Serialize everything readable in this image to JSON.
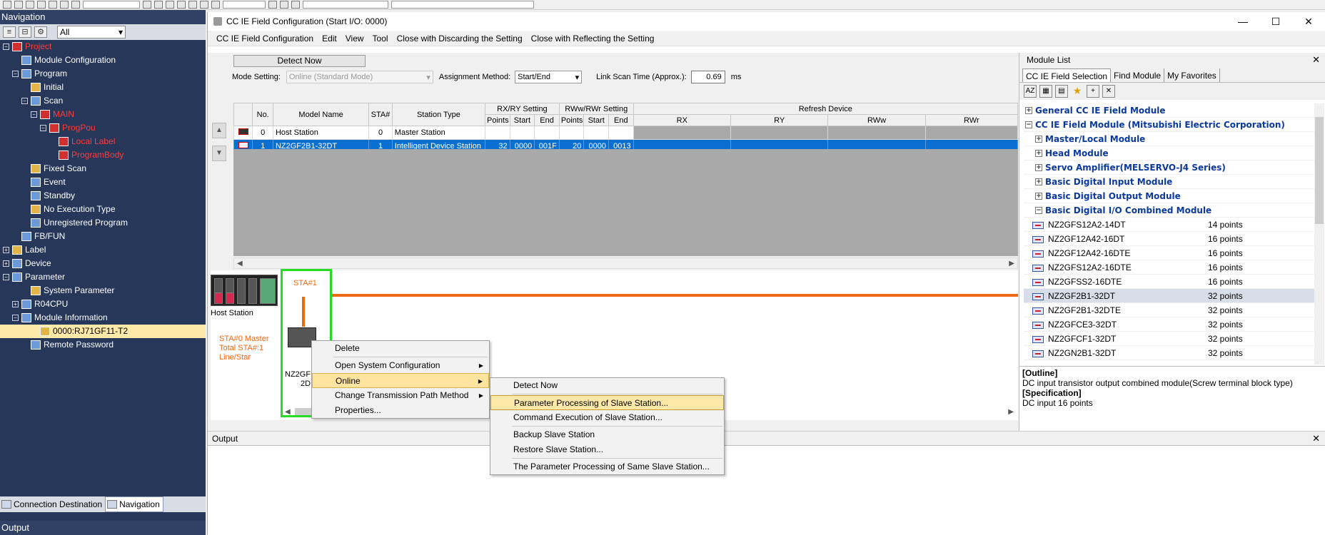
{
  "navigation": {
    "title": "Navigation",
    "filter": "All",
    "tree": [
      {
        "label": "Project",
        "indent": 0,
        "exp": "-",
        "style": "red",
        "icon": "project-icon"
      },
      {
        "label": "Module Configuration",
        "indent": 1,
        "exp": "",
        "style": "",
        "icon": "module-config-icon"
      },
      {
        "label": "Program",
        "indent": 1,
        "exp": "-",
        "style": "",
        "icon": "program-icon"
      },
      {
        "label": "Initial",
        "indent": 2,
        "exp": "",
        "style": "",
        "icon": "folder-icon"
      },
      {
        "label": "Scan",
        "indent": 2,
        "exp": "-",
        "style": "",
        "icon": "folder-icon"
      },
      {
        "label": "MAIN",
        "indent": 3,
        "exp": "-",
        "style": "red",
        "icon": "program-file-icon"
      },
      {
        "label": "ProgPou",
        "indent": 4,
        "exp": "-",
        "style": "red",
        "icon": "pou-icon"
      },
      {
        "label": "Local Label",
        "indent": 5,
        "exp": "",
        "style": "red",
        "icon": "local-label-icon"
      },
      {
        "label": "ProgramBody",
        "indent": 5,
        "exp": "",
        "style": "red",
        "icon": "program-body-icon"
      },
      {
        "label": "Fixed Scan",
        "indent": 2,
        "exp": "",
        "style": "",
        "icon": "folder-icon"
      },
      {
        "label": "Event",
        "indent": 2,
        "exp": "",
        "style": "",
        "icon": "folder-icon"
      },
      {
        "label": "Standby",
        "indent": 2,
        "exp": "",
        "style": "",
        "icon": "folder-icon"
      },
      {
        "label": "No Execution Type",
        "indent": 2,
        "exp": "",
        "style": "",
        "icon": "folder-icon"
      },
      {
        "label": "Unregistered Program",
        "indent": 2,
        "exp": "",
        "style": "",
        "icon": "folder-icon"
      },
      {
        "label": "FB/FUN",
        "indent": 1,
        "exp": "",
        "style": "",
        "icon": "fb-icon"
      },
      {
        "label": "Label",
        "indent": 0,
        "exp": "+",
        "style": "",
        "icon": "label-icon"
      },
      {
        "label": "Device",
        "indent": 0,
        "exp": "+",
        "style": "",
        "icon": "device-icon"
      },
      {
        "label": "Parameter",
        "indent": 0,
        "exp": "-",
        "style": "",
        "icon": "parameter-icon"
      },
      {
        "label": "System Parameter",
        "indent": 2,
        "exp": "",
        "style": "",
        "icon": "system-parameter-icon"
      },
      {
        "label": "R04CPU",
        "indent": 1,
        "exp": "+",
        "style": "",
        "icon": "cpu-icon"
      },
      {
        "label": "Module Information",
        "indent": 1,
        "exp": "-",
        "style": "",
        "icon": "module-info-icon"
      },
      {
        "label": "0000:RJ71GF11-T2",
        "indent": 3,
        "exp": "",
        "style": "selected",
        "icon": "module-icon"
      },
      {
        "label": "Remote Password",
        "indent": 2,
        "exp": "",
        "style": "",
        "icon": "password-icon"
      }
    ],
    "tabs": [
      "Connection Destination",
      "Navigation"
    ],
    "output_label": "Output"
  },
  "window": {
    "title": "CC IE Field Configuration (Start I/O: 0000)",
    "menu": [
      "CC IE Field Configuration",
      "Edit",
      "View",
      "Tool",
      "Close with Discarding the Setting",
      "Close with Reflecting the Setting"
    ]
  },
  "config": {
    "detect_now": "Detect Now",
    "mode_label": "Mode Setting:",
    "mode_value": "Online (Standard Mode)",
    "assign_label": "Assignment Method:",
    "assign_value": "Start/End",
    "scan_label": "Link Scan Time (Approx.):",
    "scan_value": "0.69",
    "scan_unit": "ms"
  },
  "table": {
    "group_headers": {
      "rxry": "RX/RY Setting",
      "rwwrwr": "RWw/RWr Setting",
      "refresh": "Refresh Device"
    },
    "headers": {
      "no": "No.",
      "model": "Model Name",
      "sta": "STA#",
      "type": "Station Type",
      "points": "Points",
      "start": "Start",
      "end": "End",
      "points2": "Points",
      "start2": "Start",
      "end2": "End",
      "rx": "RX",
      "ry": "RY",
      "rww": "RWw",
      "rwr": "RWr"
    },
    "rows": [
      {
        "no": "0",
        "model": "Host Station",
        "sta": "0",
        "type": "Master Station",
        "rx_points": "",
        "rx_start": "",
        "rx_end": "",
        "rw_points": "",
        "rw_start": "",
        "rw_end": ""
      },
      {
        "no": "1",
        "model": "NZ2GF2B1-32DT",
        "sta": "1",
        "type": "Intelligent Device Station",
        "rx_points": "32",
        "rx_start": "0000",
        "rx_end": "001F",
        "rw_points": "20",
        "rw_start": "0000",
        "rw_end": "0013"
      }
    ]
  },
  "diagram": {
    "host_label": "Host Station",
    "sta1_label": "STA#1",
    "sta0_line1": "STA#0  Master",
    "sta0_line2": "Total STA#:1",
    "sta0_line3": "Line/Star",
    "slave_line1": "NZ2GF",
    "slave_line2": "2D"
  },
  "context_menu": {
    "items": [
      "Delete",
      "Open System Configuration",
      "Online",
      "Change Transmission Path Method",
      "Properties..."
    ]
  },
  "online_submenu": {
    "items": [
      "Detect Now",
      "Parameter Processing of Slave Station...",
      "Command Execution of Slave Station...",
      "Backup Slave Station",
      "Restore Slave Station...",
      "The Parameter Processing of Same Slave Station..."
    ]
  },
  "output": {
    "title": "Output"
  },
  "module_list": {
    "title": "Module List",
    "tabs": [
      "CC IE Field Selection",
      "Find Module",
      "My Favorites"
    ],
    "categories": [
      {
        "label": "General CC IE Field Module",
        "indent": 0,
        "exp": "+"
      },
      {
        "label": "CC IE Field Module (Mitsubishi Electric Corporation)",
        "indent": 0,
        "exp": "-"
      },
      {
        "label": "Master/Local Module",
        "indent": 1,
        "exp": "+"
      },
      {
        "label": "Head Module",
        "indent": 1,
        "exp": "+"
      },
      {
        "label": "Servo Amplifier(MELSERVO-J4 Series)",
        "indent": 1,
        "exp": "+"
      },
      {
        "label": "Basic Digital Input Module",
        "indent": 1,
        "exp": "+"
      },
      {
        "label": "Basic Digital Output Module",
        "indent": 1,
        "exp": "+"
      },
      {
        "label": "Basic Digital I/O Combined Module",
        "indent": 1,
        "exp": "-"
      }
    ],
    "modules": [
      {
        "name": "NZ2GFS12A2-14DT",
        "points": "14 points",
        "sel": false
      },
      {
        "name": "NZ2GF12A42-16DT",
        "points": "16 points",
        "sel": false
      },
      {
        "name": "NZ2GF12A42-16DTE",
        "points": "16 points",
        "sel": false
      },
      {
        "name": "NZ2GFS12A2-16DTE",
        "points": "16 points",
        "sel": false
      },
      {
        "name": "NZ2GFSS2-16DTE",
        "points": "16 points",
        "sel": false
      },
      {
        "name": "NZ2GF2B1-32DT",
        "points": "32 points",
        "sel": true
      },
      {
        "name": "NZ2GF2B1-32DTE",
        "points": "32 points",
        "sel": false
      },
      {
        "name": "NZ2GFCE3-32DT",
        "points": "32 points",
        "sel": false
      },
      {
        "name": "NZ2GFCF1-32DT",
        "points": "32 points",
        "sel": false
      },
      {
        "name": "NZ2GN2B1-32DT",
        "points": "32 points",
        "sel": false
      }
    ],
    "outline_head": "[Outline]",
    "outline_text": "DC input transistor output combined module(Screw terminal block type)",
    "spec_head": "[Specification]",
    "spec_text": "DC input 16 points"
  },
  "colors": {
    "accent_orange": "#f06a16",
    "selection_blue": "#0a6fd0",
    "nav_bg": "#26375a",
    "highlight": "#ffe4a0"
  }
}
